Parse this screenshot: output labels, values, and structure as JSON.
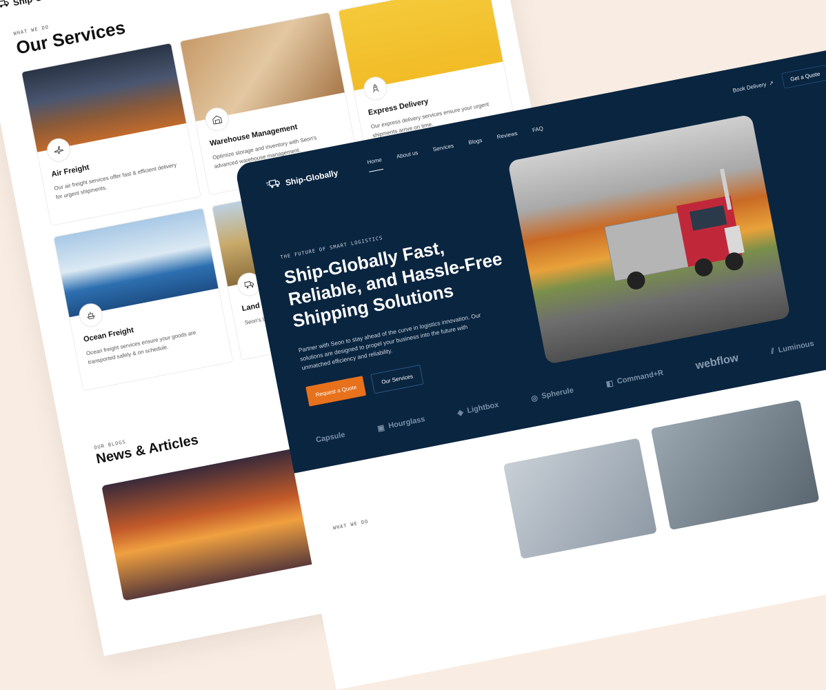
{
  "back": {
    "logo": "Ship-G",
    "eyebrow": "WHAT WE DO",
    "title": "Our Services",
    "services": [
      {
        "title": "Air Freight",
        "desc": "Our air freight services offer fast & efficient delivery for urgent shipments.",
        "icon": "airplane-icon"
      },
      {
        "title": "Warehouse Management",
        "desc": "Optimize storage and inventory with Seon's advanced warehouse management.",
        "icon": "warehouse-icon"
      },
      {
        "title": "Express Delivery",
        "desc": "Our express delivery services ensure your urgent shipments arrive on time.",
        "icon": "rocket-icon"
      },
      {
        "title": "Ocean Freight",
        "desc": "Ocean freight services ensure your goods are transported safely & on schedule.",
        "icon": "ship-icon"
      },
      {
        "title": "Land Transp",
        "desc": "Seon's Land Exp & reliable transpo",
        "icon": "truck-icon"
      }
    ],
    "blogs_eyebrow": "OUR BLOGS",
    "blogs_title": "News & Articles"
  },
  "front": {
    "logo": "Ship-Globally",
    "nav": [
      "Home",
      "About us",
      "Services",
      "Blogs",
      "Reviews",
      "FAQ"
    ],
    "book": "Book Delivery",
    "quote": "Get a Quote",
    "eyebrow": "THE FUTURE OF SMART LOGISTICS",
    "headline": "Ship-Globally Fast, Reliable, and Hassle-Free Shipping Solutions",
    "desc": "Partner with Seon to stay ahead of the curve in logistics innovation. Our solutions are designed to propel your business into the future with unmatched efficiency and reliability.",
    "primary_btn": "Request a Quote",
    "secondary_btn": "Our Services",
    "brands": [
      "Capsule",
      "Hourglass",
      "Lightbox",
      "Spherule",
      "Command+R",
      "webflow",
      "Luminous"
    ],
    "section_eyebrow": "WHAT WE DO"
  },
  "colors": {
    "navy": "#0a2540",
    "accent": "#e8711c",
    "background": "#f9ede3"
  }
}
